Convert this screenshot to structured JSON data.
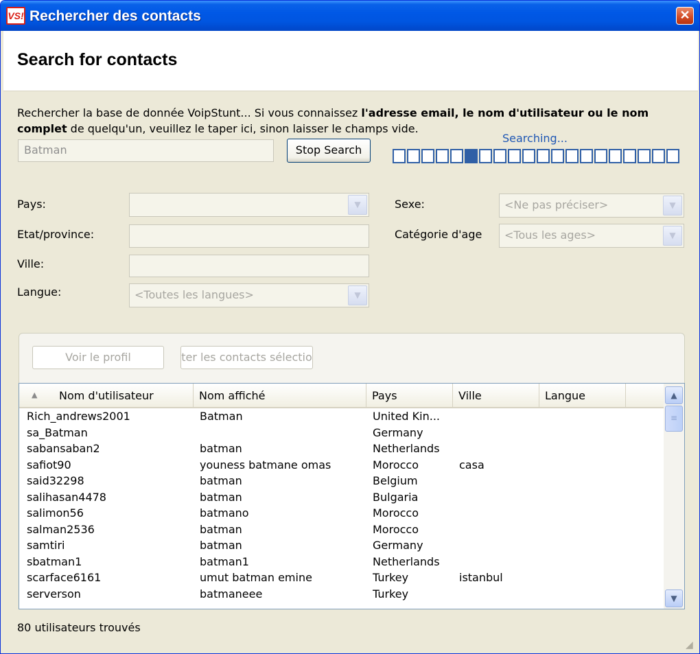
{
  "window": {
    "title": "Rechercher des contacts",
    "logo_text": "VS!",
    "close_glyph": "✕"
  },
  "header": {
    "title": "Search for contacts"
  },
  "description": {
    "part1": "Rechercher la base de donnée VoipStunt... Si vous connaissez ",
    "bold1": "l'adresse email, le nom d'utilisateur ou le nom complet",
    "part2": " de quelqu'un, veuillez le taper ici, sinon laisser le champs vide."
  },
  "search": {
    "value": "Batman",
    "stop_label": "Stop Search",
    "status": "Searching..."
  },
  "progress": {
    "total_cells": 20,
    "active_index": 5
  },
  "form": {
    "pays_label": "Pays:",
    "pays_value": "",
    "etat_label": "Etat/province:",
    "etat_value": "",
    "ville_label": "Ville:",
    "ville_value": "",
    "langue_label": "Langue:",
    "langue_value": "<Toutes les langues>",
    "sexe_label": "Sexe:",
    "sexe_value": "<Ne pas préciser>",
    "age_label": "Catégorie d'age",
    "age_value": "<Tous les ages>"
  },
  "actions": {
    "profile_label": "Voir le profil",
    "add_label": "ter les contacts sélectio"
  },
  "table": {
    "columns": [
      "Nom d'utilisateur",
      "Nom affiché",
      "Pays",
      "Ville",
      "Langue"
    ],
    "rows": [
      [
        "Rich_andrews2001",
        "Batman",
        "United Kin...",
        "",
        ""
      ],
      [
        "sa_Batman",
        "",
        "Germany",
        "",
        ""
      ],
      [
        "sabansaban2",
        "batman",
        "Netherlands",
        "",
        ""
      ],
      [
        "safiot90",
        "youness batmane omas",
        "Morocco",
        "casa",
        ""
      ],
      [
        "said32298",
        "batman",
        "Belgium",
        "",
        ""
      ],
      [
        "salihasan4478",
        "batman",
        "Bulgaria",
        "",
        ""
      ],
      [
        "salimon56",
        "batmano",
        "Morocco",
        "",
        ""
      ],
      [
        "salman2536",
        "batman",
        "Morocco",
        "",
        ""
      ],
      [
        "samtiri",
        "batman",
        "Germany",
        "",
        ""
      ],
      [
        "sbatman1",
        "batman1",
        "Netherlands",
        "",
        ""
      ],
      [
        "scarface6161",
        "umut batman emine",
        "Turkey",
        "istanbul",
        ""
      ],
      [
        "serverson",
        "batmaneee",
        "Turkey",
        "",
        ""
      ]
    ]
  },
  "footer": {
    "status": "80 utilisateurs trouvés"
  },
  "icons": {
    "sort": "sort-asc-icon",
    "up": "chevron-up-icon",
    "down": "chevron-down-icon"
  },
  "colors": {
    "titlebar": "#0055e0",
    "progress": "#2f5fa6",
    "status_text": "#1f57b4"
  }
}
